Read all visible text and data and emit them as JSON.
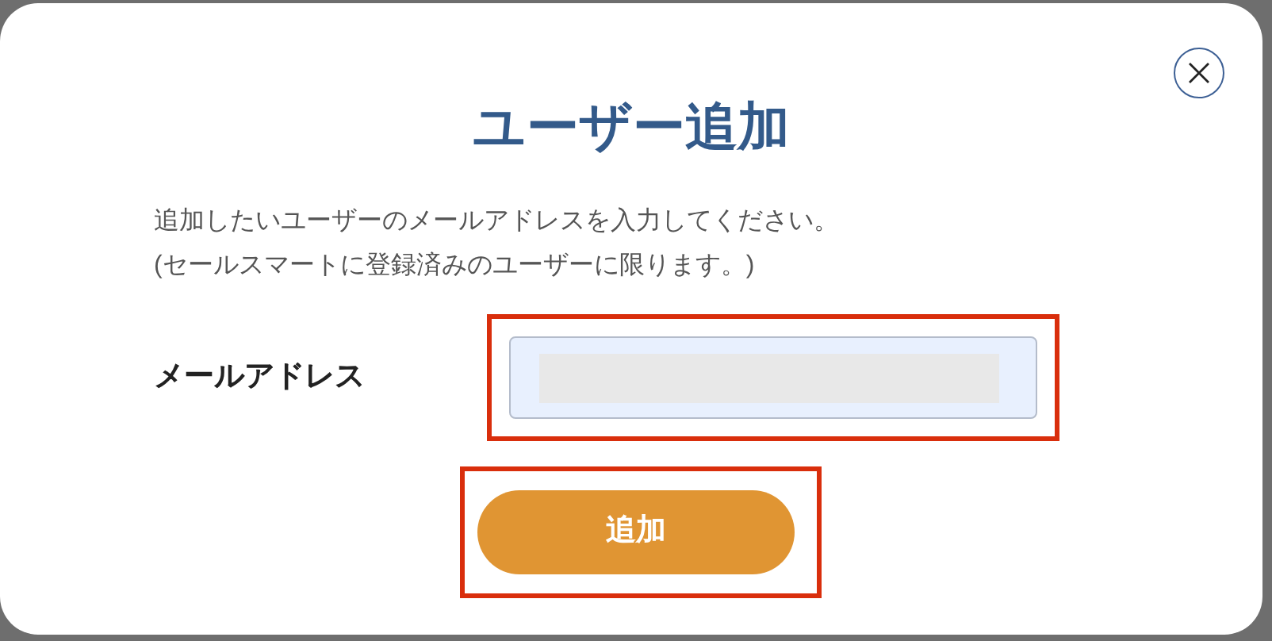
{
  "dialog": {
    "title": "ユーザー追加",
    "description": [
      "追加したいユーザーのメールアドレスを入力してください。",
      "(セールスマートに登録済みのユーザーに限ります。)"
    ],
    "email_field": {
      "label": "メールアドレス",
      "redacted": true,
      "highlighted": true
    },
    "submit_button": {
      "label": "追加",
      "highlighted": true
    }
  }
}
